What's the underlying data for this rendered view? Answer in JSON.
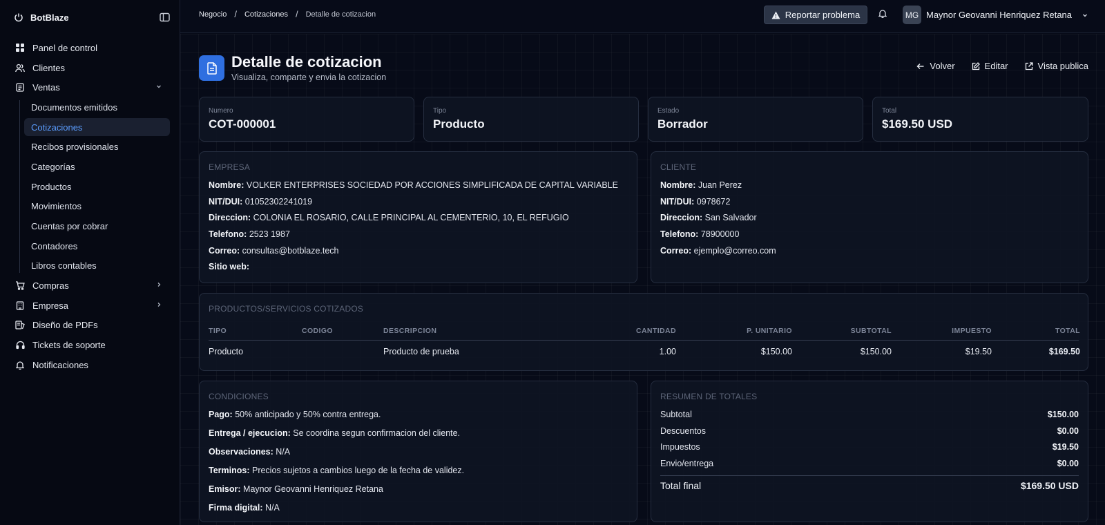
{
  "app": {
    "name": "BotBlaze"
  },
  "sidebar": {
    "items": [
      {
        "label": "Panel de control",
        "icon": "dashboard-icon"
      },
      {
        "label": "Clientes",
        "icon": "users-icon"
      },
      {
        "label": "Ventas",
        "icon": "receipt-icon",
        "expanded": true
      },
      {
        "label": "Compras",
        "icon": "cart-icon"
      },
      {
        "label": "Empresa",
        "icon": "building-icon"
      },
      {
        "label": "Diseño de PDFs",
        "icon": "pdf-design-icon"
      },
      {
        "label": "Tickets de soporte",
        "icon": "headset-icon"
      },
      {
        "label": "Notificaciones",
        "icon": "bell-icon"
      }
    ],
    "ventas_sub": [
      {
        "label": "Documentos emitidos"
      },
      {
        "label": "Cotizaciones",
        "active": true
      },
      {
        "label": "Recibos provisionales"
      },
      {
        "label": "Categorías"
      },
      {
        "label": "Productos"
      },
      {
        "label": "Movimientos"
      },
      {
        "label": "Cuentas por cobrar"
      },
      {
        "label": "Contadores"
      },
      {
        "label": "Libros contables"
      }
    ]
  },
  "topbar": {
    "breadcrumb": [
      "Negocio",
      "Cotizaciones",
      "Detalle de cotizacion"
    ],
    "report_label": "Reportar problema",
    "user_initials": "MG",
    "user_name": "Maynor Geovanni Henriquez Retana"
  },
  "header": {
    "title": "Detalle de cotizacion",
    "subtitle": "Visualiza, comparte y envia la cotizacion",
    "back_label": "Volver",
    "edit_label": "Editar",
    "public_label": "Vista publica"
  },
  "stats": [
    {
      "label": "Numero",
      "value": "COT-000001"
    },
    {
      "label": "Tipo",
      "value": "Producto"
    },
    {
      "label": "Estado",
      "value": "Borrador"
    },
    {
      "label": "Total",
      "value": "$169.50 USD"
    }
  ],
  "empresa": {
    "title": "EMPRESA",
    "fields": [
      {
        "k": "Nombre:",
        "v": "VOLKER ENTERPRISES SOCIEDAD POR ACCIONES SIMPLIFICADA DE CAPITAL VARIABLE"
      },
      {
        "k": "NIT/DUI:",
        "v": "01052302241019"
      },
      {
        "k": "Direccion:",
        "v": "COLONIA EL ROSARIO, CALLE PRINCIPAL AL CEMENTERIO, 10, EL REFUGIO"
      },
      {
        "k": "Telefono:",
        "v": "2523 1987"
      },
      {
        "k": "Correo:",
        "v": "consultas@botblaze.tech"
      },
      {
        "k": "Sitio web:",
        "v": ""
      }
    ]
  },
  "cliente": {
    "title": "CLIENTE",
    "fields": [
      {
        "k": "Nombre:",
        "v": "Juan Perez"
      },
      {
        "k": "NIT/DUI:",
        "v": "0978672"
      },
      {
        "k": "Direccion:",
        "v": "San Salvador"
      },
      {
        "k": "Telefono:",
        "v": "78900000"
      },
      {
        "k": "Correo:",
        "v": "ejemplo@correo.com"
      }
    ]
  },
  "productos": {
    "title": "PRODUCTOS/SERVICIOS COTIZADOS",
    "headers": [
      "TIPO",
      "CODIGO",
      "DESCRIPCION",
      "CANTIDAD",
      "P. UNITARIO",
      "SUBTOTAL",
      "IMPUESTO",
      "TOTAL"
    ],
    "rows": [
      [
        "Producto",
        "",
        "Producto de prueba",
        "1.00",
        "$150.00",
        "$150.00",
        "$19.50",
        "$169.50"
      ]
    ]
  },
  "condiciones": {
    "title": "CONDICIONES",
    "fields": [
      {
        "k": "Pago:",
        "v": "50% anticipado y 50% contra entrega."
      },
      {
        "k": "Entrega / ejecucion:",
        "v": "Se coordina segun confirmacion del cliente."
      },
      {
        "k": "Observaciones:",
        "v": "N/A"
      },
      {
        "k": "Terminos:",
        "v": "Precios sujetos a cambios luego de la fecha de validez."
      },
      {
        "k": "Emisor:",
        "v": "Maynor Geovanni Henriquez Retana"
      },
      {
        "k": "Firma digital:",
        "v": "N/A"
      }
    ]
  },
  "resumen": {
    "title": "RESUMEN DE TOTALES",
    "rows": [
      {
        "k": "Subtotal",
        "v": "$150.00"
      },
      {
        "k": "Descuentos",
        "v": "$0.00"
      },
      {
        "k": "Impuestos",
        "v": "$19.50"
      },
      {
        "k": "Envio/entrega",
        "v": "$0.00"
      }
    ],
    "final_label": "Total final",
    "final_value": "$169.50 USD"
  },
  "colors": {
    "accent": "#2f6fe0",
    "active_text": "#5b9dff",
    "background": "#070b18"
  }
}
